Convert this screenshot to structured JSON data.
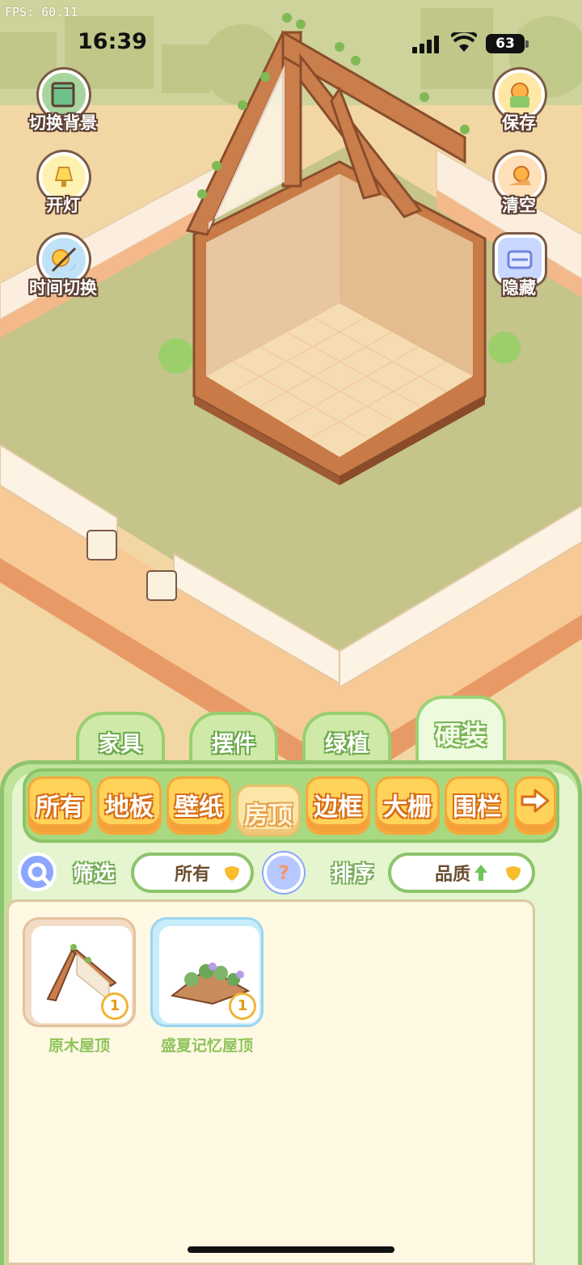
{
  "debug": {
    "fps": "FPS: 60.11"
  },
  "status_bar": {
    "time": "16:39",
    "battery": "63"
  },
  "side_buttons": {
    "left": [
      {
        "label": "切换背景",
        "icon": "background-map-icon"
      },
      {
        "label": "开灯",
        "icon": "lamp-icon"
      },
      {
        "label": "时间切换",
        "icon": "sun-moon-icon"
      }
    ],
    "right": [
      {
        "label": "保存",
        "icon": "duck-save-icon"
      },
      {
        "label": "清空",
        "icon": "duck-clear-icon"
      },
      {
        "label": "隐藏",
        "icon": "hide-frame-icon"
      }
    ]
  },
  "main_tabs": [
    {
      "label": "家具",
      "active": false
    },
    {
      "label": "摆件",
      "active": false
    },
    {
      "label": "绿植",
      "active": false
    },
    {
      "label": "硬装",
      "active": true
    }
  ],
  "categories": [
    {
      "label": "所有",
      "active": false
    },
    {
      "label": "地板",
      "active": false
    },
    {
      "label": "壁纸",
      "active": false
    },
    {
      "label": "房顶",
      "active": true
    },
    {
      "label": "边框",
      "active": false
    },
    {
      "label": "大栅",
      "active": false
    },
    {
      "label": "围栏",
      "active": false
    }
  ],
  "filter": {
    "filter_label": "筛选",
    "filter_value": "所有",
    "help": "?",
    "sort_label": "排序",
    "sort_value": "品质"
  },
  "items": [
    {
      "name": "原木屋顶",
      "count": "1",
      "frame_color": "#e8c9a6"
    },
    {
      "name": "盛夏记忆屋顶",
      "count": "1",
      "frame_color": "#a7dcf5"
    }
  ],
  "colors": {
    "lawn": "#c4c489",
    "wood": "#c77a48",
    "panel_green": "#bfe39a",
    "category_orange": "#ffd35a"
  }
}
